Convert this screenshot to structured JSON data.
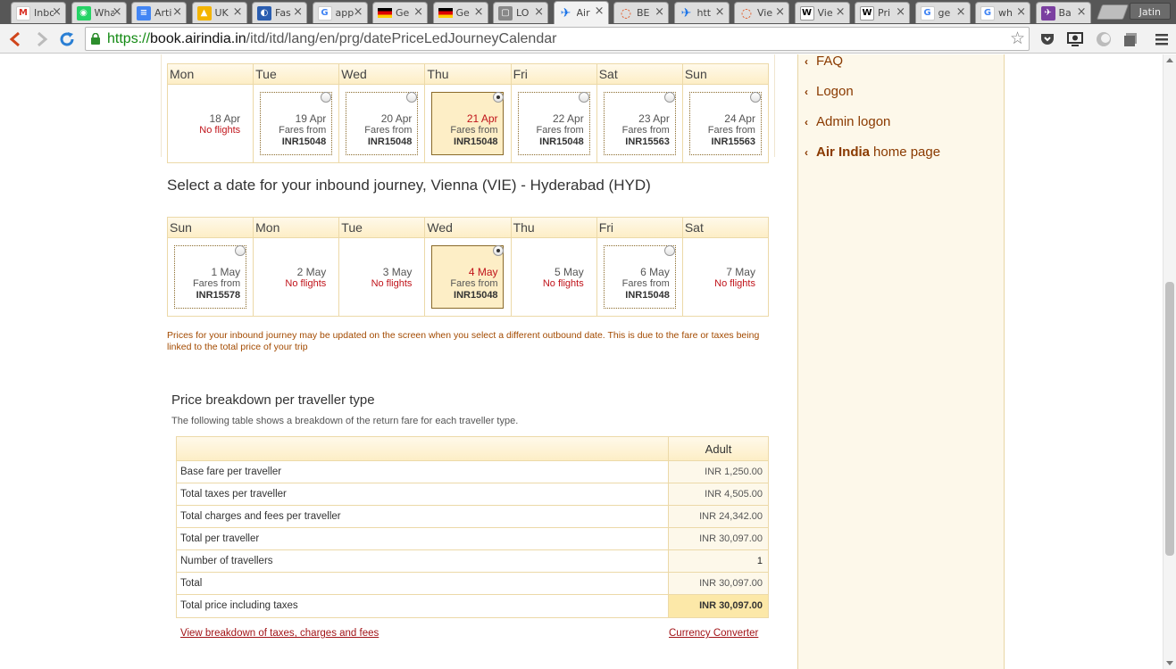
{
  "browser": {
    "tabs": [
      {
        "title": "Inbox",
        "favicon": "gmail-icon",
        "color": "#d93025"
      },
      {
        "title": "WhatsApp",
        "favicon": "whatsapp-icon",
        "color": "#25d366"
      },
      {
        "title": "Arti",
        "favicon": "docs-icon",
        "color": "#4285f4"
      },
      {
        "title": "UK",
        "favicon": "drive-icon",
        "color": "#f4b400"
      },
      {
        "title": "Fas",
        "favicon": "globe-icon",
        "color": "#2a5db0"
      },
      {
        "title": "app",
        "favicon": "google-icon",
        "color": "#4285f4"
      },
      {
        "title": "Ge",
        "favicon": "german-flag-icon",
        "color": "#000000"
      },
      {
        "title": "Ge",
        "favicon": "german-flag-icon",
        "color": "#000000"
      },
      {
        "title": "LO",
        "favicon": "page-icon",
        "color": "#888888"
      },
      {
        "title": "Air",
        "favicon": "airplane-icon",
        "color": "#1a73e8"
      },
      {
        "title": "BE",
        "favicon": "spinner-icon",
        "color": "#e2501a"
      },
      {
        "title": "htt",
        "favicon": "airplane-icon",
        "color": "#1a73e8"
      },
      {
        "title": "Vie",
        "favicon": "spinner-icon",
        "color": "#e2501a"
      },
      {
        "title": "Vie",
        "favicon": "wikipedia-icon",
        "color": "#ffffff"
      },
      {
        "title": "Pri",
        "favicon": "wikipedia-icon",
        "color": "#ffffff"
      },
      {
        "title": "ge",
        "favicon": "google-icon",
        "color": "#4285f4"
      },
      {
        "title": "wh",
        "favicon": "google-icon",
        "color": "#4285f4"
      },
      {
        "title": "Ba",
        "favicon": "plane-app-icon",
        "color": "#7b3fa0"
      }
    ],
    "active_tab_index": 9,
    "profile_name": "Jatin",
    "url_scheme": "https://",
    "url_host": "book.airindia.in",
    "url_path": "/itd/itd/lang/en/prg/datePriceLedJourneyCalendar"
  },
  "outbound_calendar": {
    "days": [
      "Mon",
      "Tue",
      "Wed",
      "Thu",
      "Fri",
      "Sat",
      "Sun"
    ],
    "cells": [
      {
        "date": "18 Apr",
        "available": false,
        "status": "No flights",
        "selected": false
      },
      {
        "date": "19 Apr",
        "available": true,
        "fares_from": "Fares from",
        "price": "INR15048",
        "selected": false
      },
      {
        "date": "20 Apr",
        "available": true,
        "fares_from": "Fares from",
        "price": "INR15048",
        "selected": false
      },
      {
        "date": "21 Apr",
        "available": true,
        "fares_from": "Fares from",
        "price": "INR15048",
        "selected": true
      },
      {
        "date": "22 Apr",
        "available": true,
        "fares_from": "Fares from",
        "price": "INR15048",
        "selected": false
      },
      {
        "date": "23 Apr",
        "available": true,
        "fares_from": "Fares from",
        "price": "INR15563",
        "selected": false
      },
      {
        "date": "24 Apr",
        "available": true,
        "fares_from": "Fares from",
        "price": "INR15563",
        "selected": false
      }
    ]
  },
  "inbound_title": "Select a date for your inbound journey, Vienna (VIE) - Hyderabad (HYD)",
  "inbound_calendar": {
    "days": [
      "Sun",
      "Mon",
      "Tue",
      "Wed",
      "Thu",
      "Fri",
      "Sat"
    ],
    "cells": [
      {
        "date": "1 May",
        "available": true,
        "fares_from": "Fares from",
        "price": "INR15578",
        "selected": false
      },
      {
        "date": "2 May",
        "available": false,
        "status": "No flights",
        "selected": false
      },
      {
        "date": "3 May",
        "available": false,
        "status": "No flights",
        "selected": false
      },
      {
        "date": "4 May",
        "available": true,
        "fares_from": "Fares from",
        "price": "INR15048",
        "selected": true
      },
      {
        "date": "5 May",
        "available": false,
        "status": "No flights",
        "selected": false
      },
      {
        "date": "6 May",
        "available": true,
        "fares_from": "Fares from",
        "price": "INR15048",
        "selected": false
      },
      {
        "date": "7 May",
        "available": false,
        "status": "No flights",
        "selected": false
      }
    ]
  },
  "note": "Prices for your inbound journey may be updated on the screen when you select a different outbound date. This is due to the fare or taxes being linked to the total price of your trip",
  "breakdown": {
    "title": "Price breakdown per traveller type",
    "description": "The following table shows a breakdown of the return fare for each traveller type.",
    "column_header": "Adult",
    "rows": [
      {
        "label": "Base fare per traveller",
        "value": "INR 1,250.00"
      },
      {
        "label": "Total taxes per traveller",
        "value": "INR 4,505.00"
      },
      {
        "label": "Total charges and fees per traveller",
        "value": "INR 24,342.00"
      },
      {
        "label": "Total per traveller",
        "value": "INR 30,097.00"
      },
      {
        "label": "Number of travellers",
        "value": "1"
      },
      {
        "label": "Total",
        "value": "INR 30,097.00"
      },
      {
        "label": "Total price including taxes",
        "value": "INR 30,097.00"
      }
    ],
    "link_breakdown": "View breakdown of taxes, charges and fees",
    "link_currency": "Currency Converter"
  },
  "sidebar": {
    "faq": "FAQ",
    "logon": "Logon",
    "admin_logon": "Admin logon",
    "home_brand": "Air India",
    "home_rest": "home page"
  },
  "colors": {
    "accent": "#8a3a00",
    "alert_red": "#c0131a",
    "cell_highlight": "#fdeec6",
    "sidebar_bg": "#fdf8ea"
  }
}
